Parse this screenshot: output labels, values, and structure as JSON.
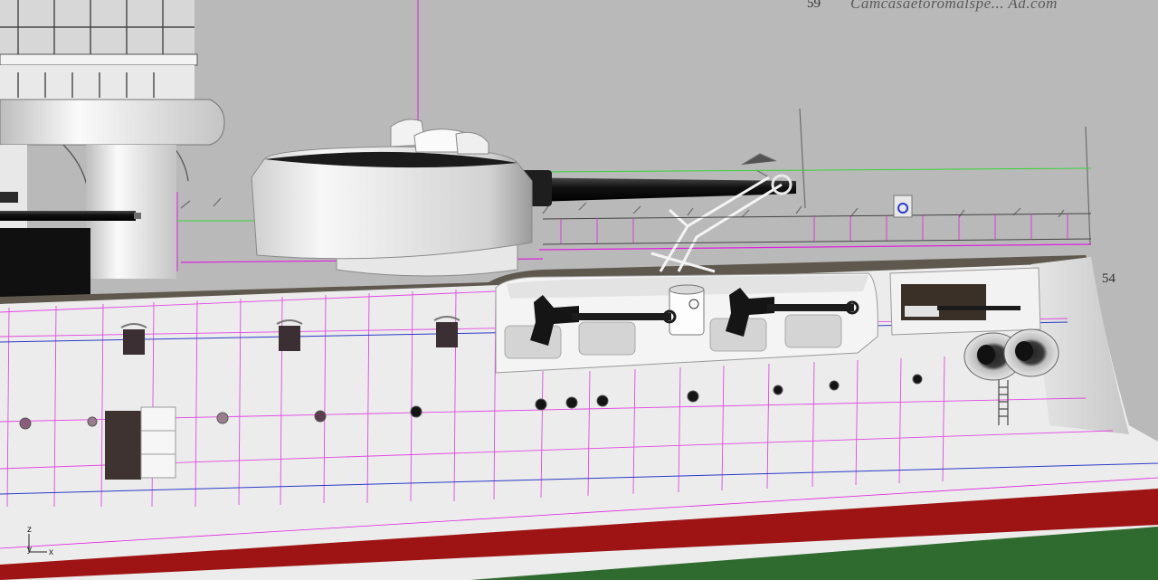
{
  "viewport": {
    "type": "3d-modeling-viewport",
    "subject": "battleship bow section model",
    "display_mode": "shaded",
    "colors": {
      "background": "#b9b9b9",
      "hull": "#efefef",
      "deck": "#5e584e",
      "boot_topping": "#9e1414",
      "antifouling": "#2f6a2f",
      "isocurve": "#e020e0",
      "guide_line": "#2a3ac8",
      "selection_green": "#36d436"
    }
  },
  "blueprint": {
    "frame_labels": [
      "59",
      "54"
    ],
    "caption": "Camcasaetoromalspe... Ad.com"
  },
  "axis_widget": {
    "labels": [
      "z",
      "y",
      "x"
    ]
  }
}
